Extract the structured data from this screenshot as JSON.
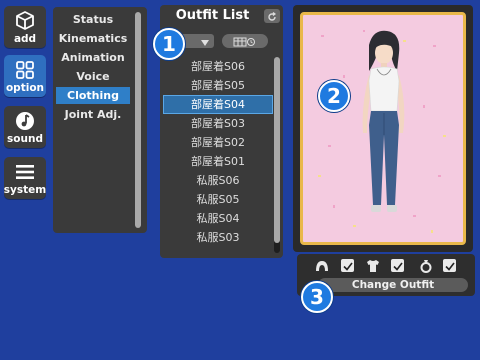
{
  "sidebar": {
    "buttons": [
      {
        "label": "add",
        "icon": "cube-icon"
      },
      {
        "label": "option",
        "icon": "grid-icon"
      },
      {
        "label": "sound",
        "icon": "music-note-icon"
      },
      {
        "label": "system",
        "icon": "menu-icon"
      }
    ],
    "active": "option"
  },
  "options": {
    "items": [
      "Status",
      "Kinematics",
      "Animation",
      "Voice",
      "Clothing",
      "Joint Adj."
    ],
    "selected": "Clothing"
  },
  "outfit_list": {
    "title": "Outfit List",
    "items": [
      "部屋着S06",
      "部屋着S05",
      "部屋着S04",
      "部屋着S03",
      "部屋着S02",
      "部屋着S01",
      "私服S06",
      "私服S05",
      "私服S04",
      "私服S03"
    ],
    "selected": "部屋着S04"
  },
  "controls": {
    "change_outfit_label": "Change Outfit",
    "toggles": [
      {
        "icon": "hair-icon",
        "checked": true
      },
      {
        "icon": "shirt-icon",
        "checked": true
      },
      {
        "icon": "ring-icon",
        "checked": true
      }
    ]
  },
  "callouts": [
    "1",
    "2",
    "3"
  ],
  "colors": {
    "background": "#1f3f9e",
    "panel": "#3a3a3a",
    "selection": "#2f7fc8",
    "preview_frame": "#e9b84a",
    "preview_bg": "#f4cbe0"
  }
}
